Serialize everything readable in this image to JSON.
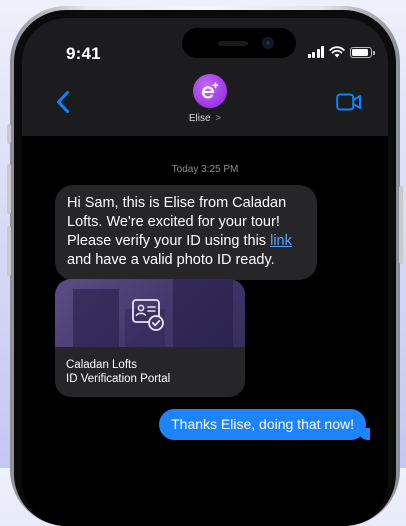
{
  "status_bar": {
    "time": "9:41"
  },
  "contact": {
    "name": "Elise",
    "chevron": ">"
  },
  "conversation": {
    "timestamp": "Today 3:25 PM",
    "incoming_message": {
      "before_link": "Hi Sam, this is Elise from Caladan Lofts. We're excited for your tour! Please verify your ID using this ",
      "link_text": "link",
      "after_link": " and have a valid photo ID ready."
    },
    "link_preview": {
      "title_line1": "Caladan Lofts",
      "title_line2": "ID Verification Portal",
      "icon": "id-card-check-icon"
    },
    "outgoing_message": "Thanks Elise, doing that now!"
  },
  "colors": {
    "incoming_bubble": "#262628",
    "outgoing_bubble": "#1d84ff",
    "accent_blue": "#0a84ff",
    "avatar_purple": "#9d34e8",
    "header_bg": "#1c1c1e"
  },
  "icons": [
    "back-chevron-icon",
    "avatar-e-icon",
    "facetime-video-icon",
    "cellular-signal-icon",
    "wifi-icon",
    "battery-icon"
  ]
}
